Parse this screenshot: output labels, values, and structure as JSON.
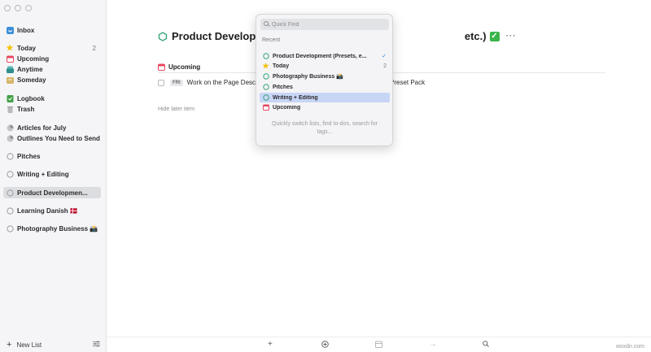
{
  "sidebar": {
    "inbox": {
      "label": "Inbox"
    },
    "today": {
      "label": "Today",
      "count": "2"
    },
    "upcoming": {
      "label": "Upcoming"
    },
    "anytime": {
      "label": "Anytime"
    },
    "someday": {
      "label": "Someday"
    },
    "logbook": {
      "label": "Logbook"
    },
    "trash": {
      "label": "Trash"
    },
    "areas": [
      {
        "label": "Articles for July"
      },
      {
        "label": "Outlines You Need to Send"
      }
    ],
    "projects": [
      {
        "label": "Pitches"
      },
      {
        "label": "Writing + Editing"
      },
      {
        "label": "Product Developmen..."
      },
      {
        "label": "Learning Danish 🇩🇰"
      },
      {
        "label": "Photography Business 📸"
      }
    ],
    "new_list": "New List"
  },
  "main": {
    "title_start": "Product Developm",
    "title_end": "etc.)",
    "heading": "Upcoming",
    "todo": {
      "day": "FRI",
      "text": "Work on the Page Descript",
      "text_end": "Preset Pack"
    },
    "hide_later": "Hide later item"
  },
  "quick_find": {
    "placeholder": "Quick Find",
    "recent_label": "Recent",
    "items": [
      {
        "label": "Product Development (Presets, e..."
      },
      {
        "label": "Today",
        "count": "2"
      },
      {
        "label": "Photography Business 📸"
      },
      {
        "label": "Pitches"
      },
      {
        "label": "Writing + Editing"
      },
      {
        "label": "Upcoming"
      }
    ],
    "hint": "Quickly switch lists, find to-dos, search for tags..."
  },
  "watermark": "wsxdn.com",
  "colors": {
    "accent": "#2f7cf6",
    "project_green": "#3aa57a",
    "today_star": "#f2c200",
    "upcoming_red": "#e8475f",
    "anytime_teal": "#2e8f8c",
    "someday_tan": "#d8b56a",
    "logbook_green": "#43a047",
    "selection": "#c8d6f6"
  },
  "icons": [
    "inbox-icon",
    "star-icon",
    "calendar-icon",
    "layers-icon",
    "archive-box-icon",
    "logbook-icon",
    "trash-icon",
    "area-icon",
    "project-circle-icon",
    "search-icon",
    "checkmark-icon",
    "more-icon",
    "settings-icon",
    "plus-icon",
    "add-circle-icon",
    "calendar-toolbar-icon",
    "arrow-right-icon"
  ]
}
